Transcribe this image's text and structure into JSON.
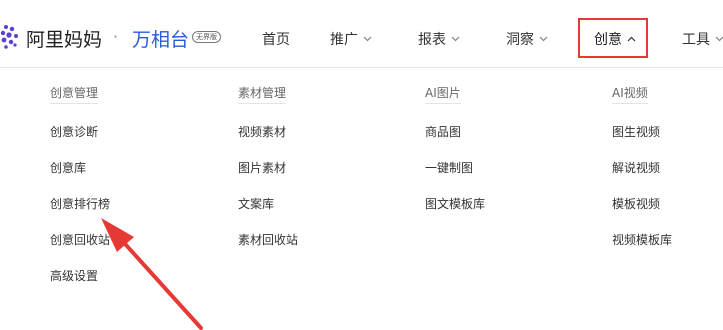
{
  "header": {
    "brand": "阿里妈妈",
    "separator": "·",
    "product": "万相台",
    "badge": "无界版",
    "nav": [
      {
        "label": "首页",
        "has_chevron": false
      },
      {
        "label": "推广",
        "has_chevron": true
      },
      {
        "label": "报表",
        "has_chevron": true
      },
      {
        "label": "洞察",
        "has_chevron": true
      },
      {
        "label": "创意",
        "has_chevron": true,
        "active": true
      },
      {
        "label": "工具",
        "has_chevron": true
      }
    ]
  },
  "dropdown": {
    "columns": [
      {
        "title": "创意管理",
        "items": [
          "创意诊断",
          "创意库",
          "创意排行榜",
          "创意回收站",
          "高级设置"
        ]
      },
      {
        "title": "素材管理",
        "items": [
          "视频素材",
          "图片素材",
          "文案库",
          "素材回收站"
        ]
      },
      {
        "title": "AI图片",
        "items": [
          "商品图",
          "一键制图",
          "图文模板库"
        ]
      },
      {
        "title": "AI视频",
        "items": [
          "图生视频",
          "解说视频",
          "模板视频",
          "视频模板库"
        ]
      }
    ]
  },
  "colors": {
    "brand_blue": "#2a5bd7",
    "logo_purple": "#5b3fd1",
    "highlight_red": "#e53935"
  },
  "icons": [
    "alimama-logo-icon",
    "chevron-down-icon",
    "chevron-up-icon",
    "red-arrow-annotation"
  ]
}
